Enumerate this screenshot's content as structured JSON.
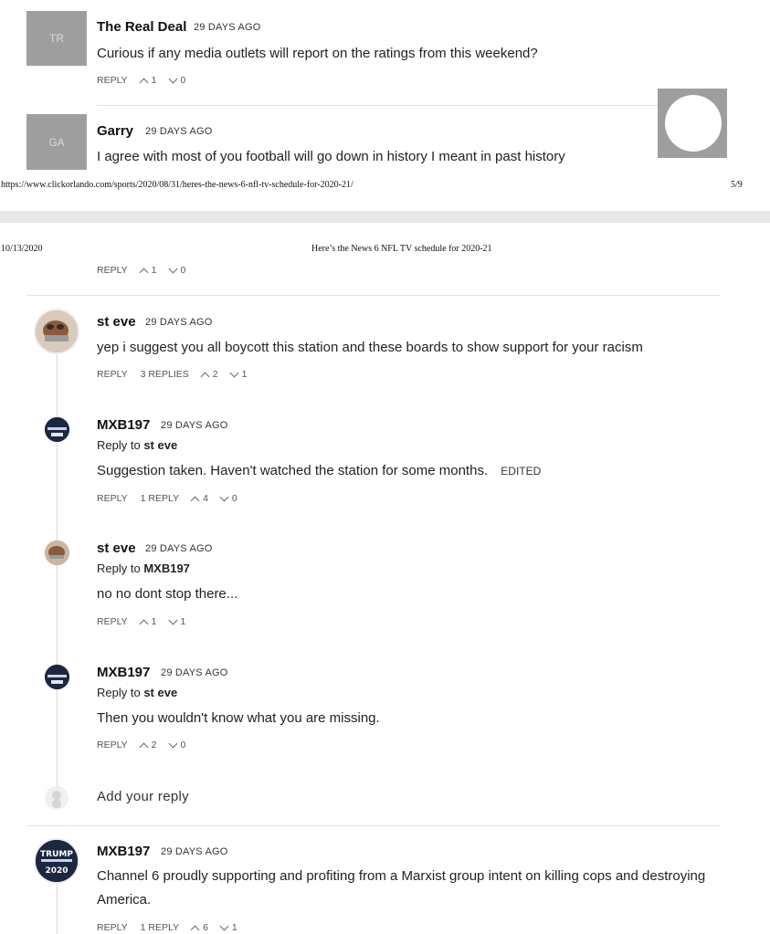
{
  "comments_top": [
    {
      "initials": "TR",
      "author": "The Real Deal",
      "time": "29 DAYS AGO",
      "text": "Curious if any media outlets will report on the ratings from this weekend?",
      "reply": "REPLY",
      "up": "1",
      "down": "0"
    },
    {
      "initials": "GA",
      "author": "Garry",
      "time": "29 DAYS AGO",
      "text": "I agree with most of you football will go down in history I meant in past history"
    }
  ],
  "print_footer": {
    "url": "https://www.clickorlando.com/sports/2020/08/31/heres-the-news-6-nfl-tv-schedule-for-2020-21/",
    "page": "5/9"
  },
  "print_header": {
    "date": "10/13/2020",
    "title": "Here’s the News 6 NFL TV schedule for 2020-21"
  },
  "garry_actions": {
    "reply": "REPLY",
    "up": "1",
    "down": "0"
  },
  "steve_main": {
    "author": "st eve",
    "time": "29 DAYS AGO",
    "text": "yep i suggest you all boycott this station and these boards to show support for your racism",
    "reply": "REPLY",
    "replies": "3 REPLIES",
    "up": "2",
    "down": "1"
  },
  "replies": [
    {
      "author": "MXB197",
      "time": "29 DAYS AGO",
      "reply_to_prefix": "Reply to",
      "reply_to": "st eve",
      "text": "Suggestion taken. Haven't watched the station for some months.",
      "edited": "EDITED",
      "reply": "REPLY",
      "replies": "1 REPLY",
      "up": "4",
      "down": "0"
    },
    {
      "author": "st eve",
      "time": "29 DAYS AGO",
      "reply_to_prefix": "Reply to",
      "reply_to": "MXB197",
      "text": "no no dont stop there...",
      "reply": "REPLY",
      "up": "1",
      "down": "1"
    },
    {
      "author": "MXB197",
      "time": "29 DAYS AGO",
      "reply_to_prefix": "Reply to",
      "reply_to": "st eve",
      "text": "Then you wouldn't know what you are missing.",
      "reply": "REPLY",
      "up": "2",
      "down": "0"
    }
  ],
  "add_reply": "Add your reply",
  "mxb_main": {
    "author": "MXB197",
    "time": "29 DAYS AGO",
    "text": "Channel 6 proudly supporting and profiting from a Marxist group intent on killing cops and destroying America.",
    "reply": "REPLY",
    "replies": "1 REPLY",
    "up": "6",
    "down": "1"
  },
  "avatar_text": {
    "trump": "TRUMP",
    "year": "2020"
  },
  "colors": {
    "avatar_gray": "#9e9e9e",
    "divider": "#e2e2e2",
    "page_gap": "#e8e8e8"
  }
}
